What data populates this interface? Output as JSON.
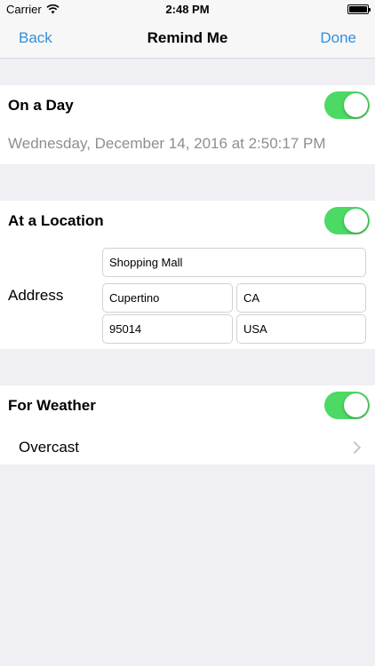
{
  "status_bar": {
    "carrier": "Carrier",
    "time": "2:48 PM",
    "icons": [
      "wifi-icon",
      "battery-icon"
    ]
  },
  "nav": {
    "back_label": "Back",
    "title": "Remind Me",
    "done_label": "Done"
  },
  "colors": {
    "accent": "#2f8fdd",
    "toggle_on": "#4cd964",
    "background": "#efeff4",
    "secondary_text": "#8e8e93"
  },
  "day_section": {
    "title": "On a Day",
    "enabled": true,
    "date": "Wednesday, December 14, 2016 at 2:50:17 PM"
  },
  "location_section": {
    "title": "At a Location",
    "enabled": true,
    "address_label": "Address",
    "street": "Shopping Mall",
    "city": "Cupertino",
    "state": "CA",
    "zip": "95014",
    "country": "USA"
  },
  "weather_section": {
    "title": "For Weather",
    "enabled": true,
    "condition": "Overcast"
  }
}
